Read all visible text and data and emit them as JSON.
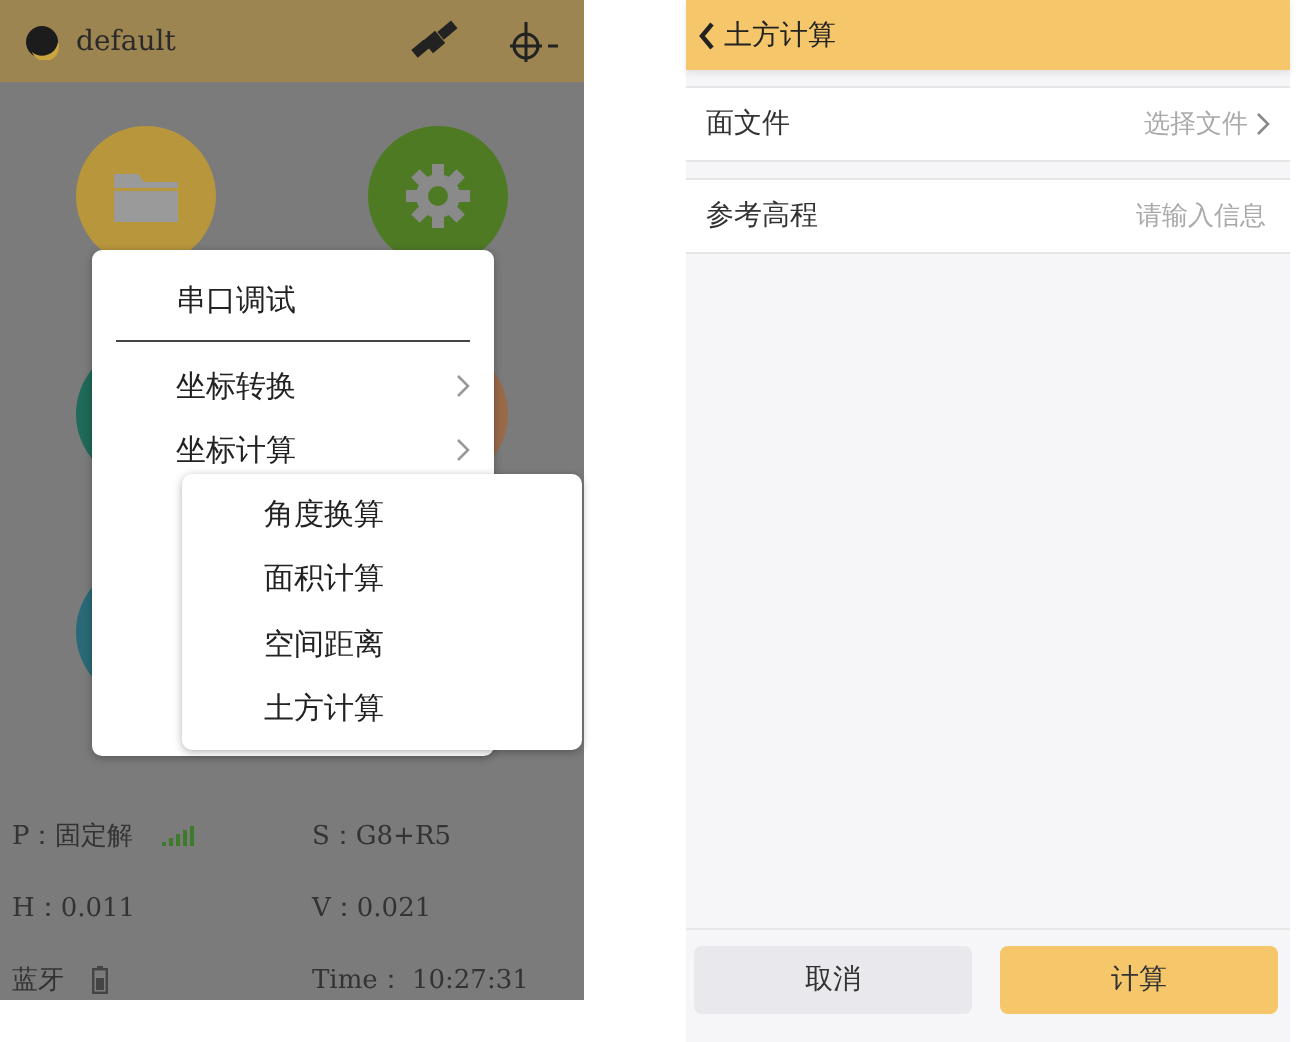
{
  "left_screen": {
    "header": {
      "title": "default"
    },
    "tiles": [
      {
        "kind": "folder",
        "color": "#b8963c"
      },
      {
        "kind": "gear",
        "color": "#4e7a24"
      },
      {
        "kind": "blank",
        "color": "#1f6a58"
      },
      {
        "kind": "blank",
        "color": "#9a6a48"
      },
      {
        "kind": "blank",
        "color": "#2a6a78"
      }
    ],
    "menu": {
      "items": [
        {
          "label": "串口调试",
          "has_submenu": false,
          "divider_after": true
        },
        {
          "label": "坐标转换",
          "has_submenu": true,
          "divider_after": false
        },
        {
          "label": "坐标计算",
          "has_submenu": true,
          "divider_after": false
        }
      ]
    },
    "submenu": {
      "items": [
        {
          "label": "角度换算"
        },
        {
          "label": "面积计算"
        },
        {
          "label": "空间距离"
        },
        {
          "label": "土方计算"
        }
      ]
    },
    "status": [
      {
        "text": "P：固定解",
        "kind": "signal"
      },
      {
        "text": "S：G8+R5",
        "kind": "text"
      },
      {
        "text": "H：0.011",
        "kind": "text"
      },
      {
        "text": "V：0.021",
        "kind": "text"
      },
      {
        "text": "蓝牙",
        "kind": "battery"
      },
      {
        "text": "Time： 10:27:31",
        "kind": "text"
      }
    ]
  },
  "right_screen": {
    "header": {
      "title": "土方计算"
    },
    "rows": [
      {
        "label": "面文件",
        "kind": "select",
        "value": "选择文件"
      },
      {
        "label": "参考高程",
        "kind": "input",
        "placeholder": "请输入信息"
      }
    ],
    "buttons": [
      {
        "label": "取消",
        "kind": "secondary"
      },
      {
        "label": "计算",
        "kind": "primary"
      }
    ]
  }
}
